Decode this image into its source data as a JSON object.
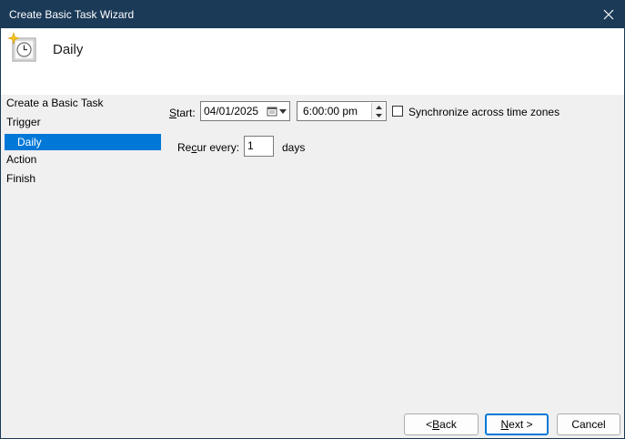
{
  "window": {
    "title": "Create Basic Task Wizard"
  },
  "header": {
    "title": "Daily",
    "icon": "task-scheduler-clock-icon"
  },
  "steps": [
    {
      "label": "Create a Basic Task",
      "selected": false
    },
    {
      "label": "Trigger",
      "selected": false
    },
    {
      "label": "Daily",
      "selected": true
    },
    {
      "label": "Action",
      "selected": false
    },
    {
      "label": "Finish",
      "selected": false
    }
  ],
  "form": {
    "start_label_pre": "",
    "start_label_key": "S",
    "start_label_post": "tart:",
    "start_date": "04/01/2025",
    "start_time": "6:00:00 pm",
    "sync_label": "Synchronize across time zones",
    "sync_checked": false,
    "recur_label_pre": "Re",
    "recur_label_key": "c",
    "recur_label_post": "ur every:",
    "recur_value": "1",
    "recur_unit": "days"
  },
  "buttons": {
    "back_pre": "< ",
    "back_key": "B",
    "back_post": "ack",
    "next_key": "N",
    "next_post": "ext >",
    "cancel": "Cancel"
  },
  "colors": {
    "titlebar": "#1b3a57",
    "selection": "#0078d7",
    "dialog_background": "#f0f0f0"
  }
}
